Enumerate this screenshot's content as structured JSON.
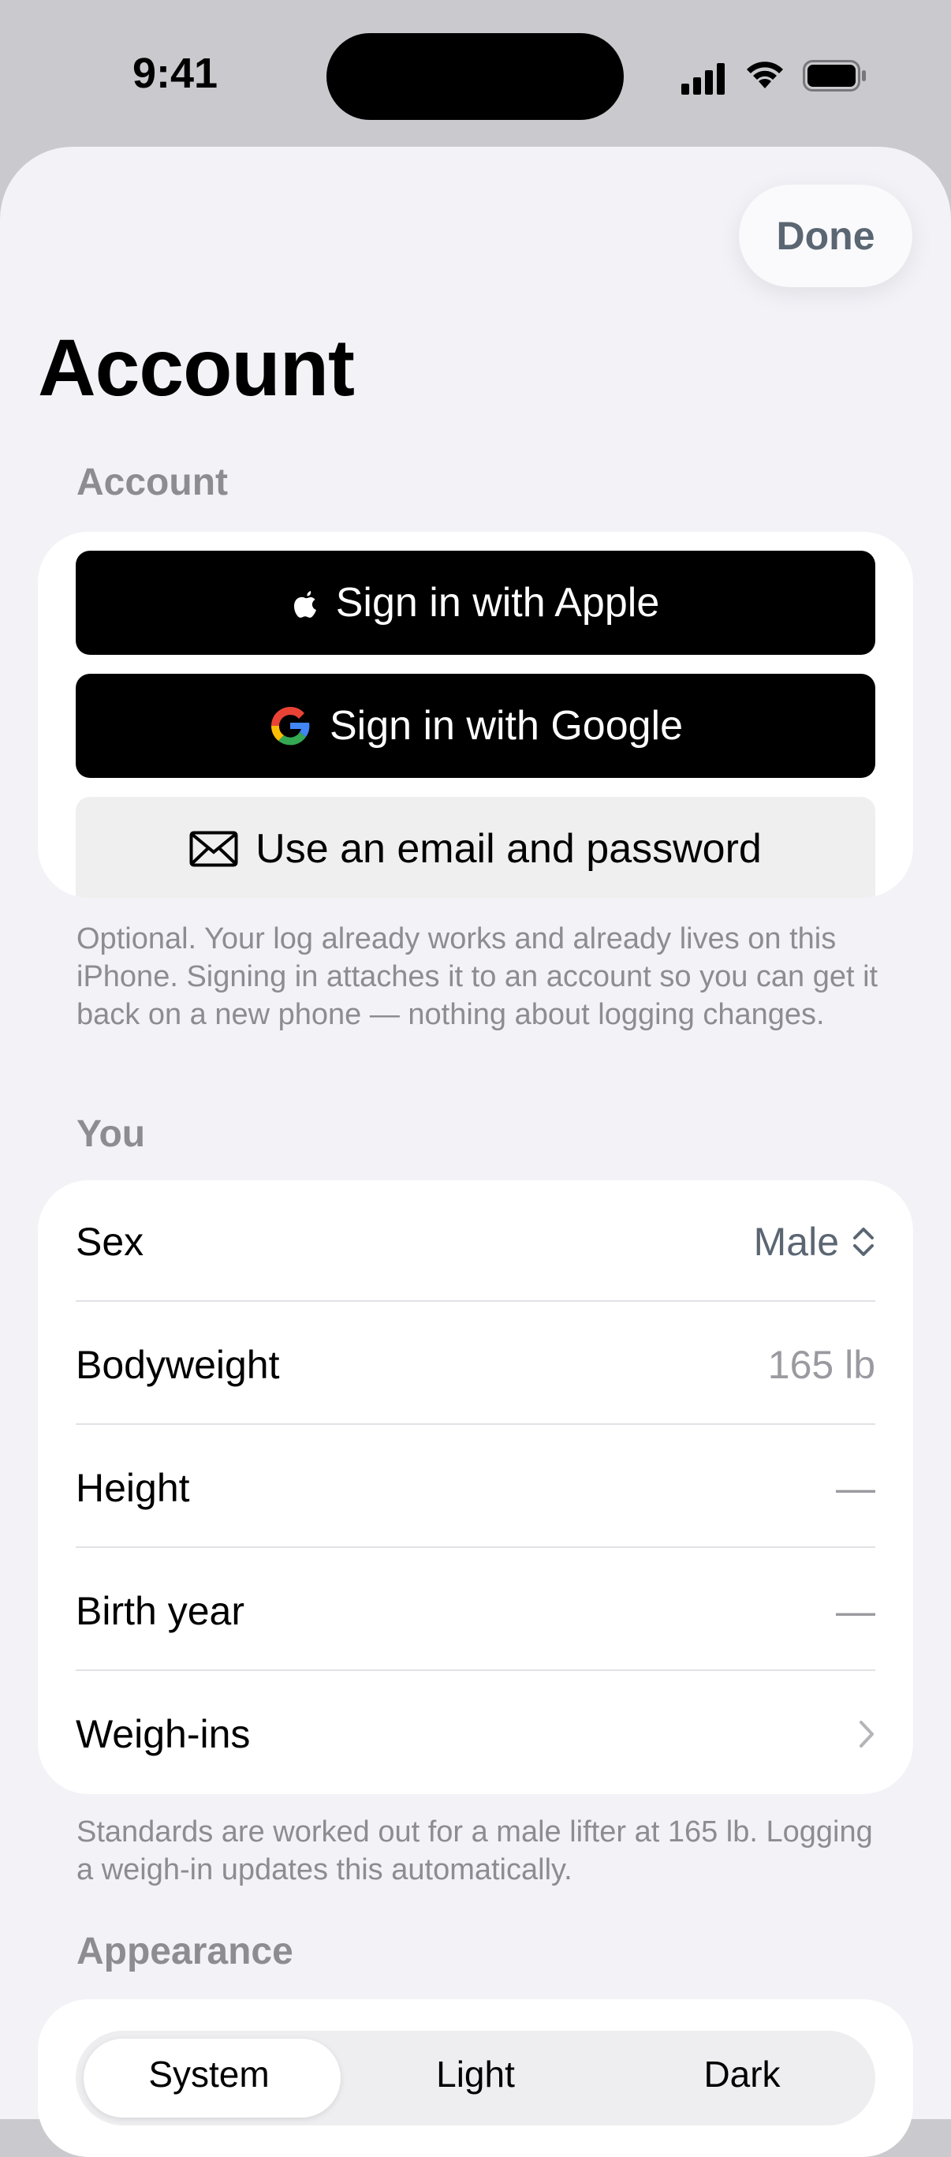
{
  "status_bar": {
    "time": "9:41"
  },
  "header": {
    "done_label": "Done",
    "title": "Account"
  },
  "account_section": {
    "header": "Account",
    "apple_button": "Sign in with Apple",
    "google_button": "Sign in with Google",
    "email_button": "Use an email and password",
    "footer": "Optional. Your log already works and already lives on this iPhone. Signing in attaches it to an account so you can get it back on a new phone — nothing about logging changes."
  },
  "you_section": {
    "header": "You",
    "rows": [
      {
        "label": "Sex",
        "value": "Male"
      },
      {
        "label": "Bodyweight",
        "value": "165 lb"
      },
      {
        "label": "Height",
        "value": "—"
      },
      {
        "label": "Birth year",
        "value": "—"
      },
      {
        "label": "Weigh-ins",
        "value": ""
      }
    ],
    "footer": "Standards are worked out for a male lifter at 165 lb. Logging a weigh-in updates this automatically."
  },
  "appearance_section": {
    "header": "Appearance",
    "options": [
      "System",
      "Light",
      "Dark"
    ],
    "selected": "System"
  },
  "colors": {
    "accent": "#5b6673",
    "secondary_text": "#8c8c91",
    "background": "#f2f2f7"
  },
  "icons": [
    "apple-logo-icon",
    "google-logo-icon",
    "envelope-icon",
    "updown-chevron-icon",
    "chevron-right-icon",
    "cellular-signal-icon",
    "wifi-icon",
    "battery-icon"
  ]
}
